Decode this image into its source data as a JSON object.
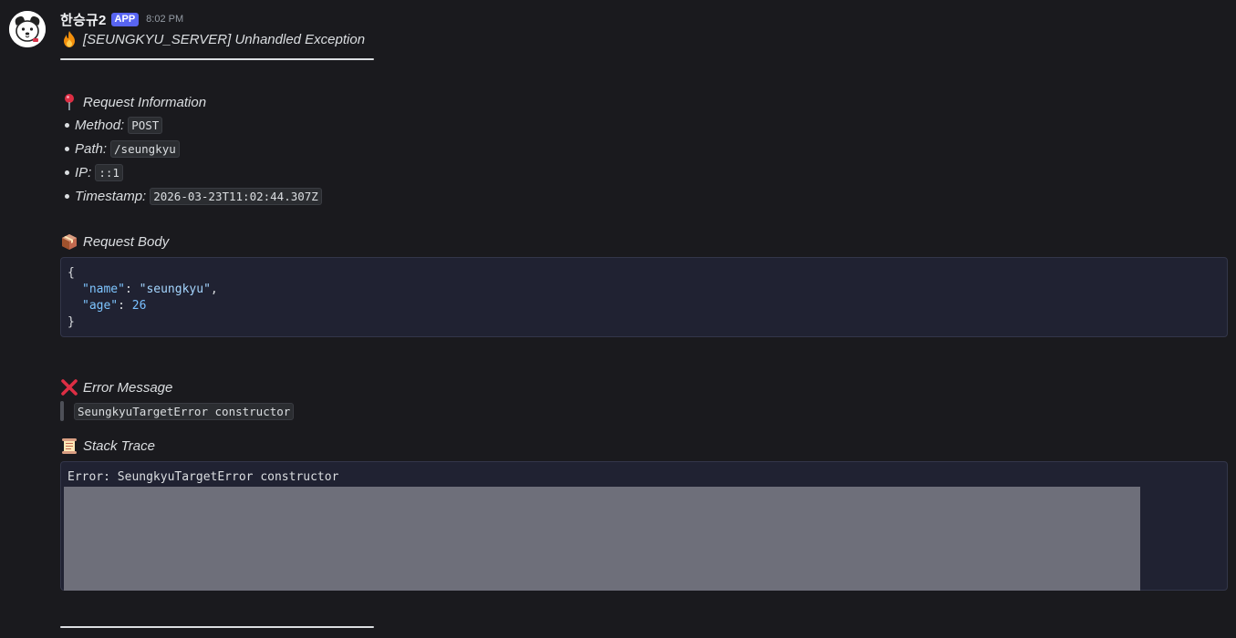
{
  "author": {
    "name": "한승규2",
    "badge": "APP",
    "time": "8:02 PM"
  },
  "title": "[SEUNGKYU_SERVER] Unhandled Exception",
  "sections": {
    "request_info": {
      "heading": "Request Information",
      "items": [
        {
          "label": "Method:",
          "value": "POST"
        },
        {
          "label": "Path:",
          "value": "/seungkyu"
        },
        {
          "label": "IP:",
          "value": "::1"
        },
        {
          "label": "Timestamp:",
          "value": "2026-03-23T11:02:44.307Z"
        }
      ]
    },
    "request_body": {
      "heading": "Request Body",
      "open": "{",
      "close": "}",
      "fields": [
        {
          "key": "\"name\"",
          "value": "\"seungkyu\"",
          "trail": ","
        },
        {
          "key": "\"age\"",
          "value": "26",
          "trail": ""
        }
      ]
    },
    "error_message": {
      "heading": "Error Message",
      "value": "SeungkyuTargetError constructor"
    },
    "stack_trace": {
      "heading": "Stack Trace",
      "first_line": "Error: SeungkyuTargetError constructor"
    }
  },
  "emoji_icons": [
    "fire-icon",
    "pushpin-icon",
    "package-icon",
    "cross-mark-icon",
    "scroll-icon"
  ],
  "colors": {
    "background": "#1a1a1e",
    "badge": "#5865f2",
    "code_block_bg": "#202232",
    "redacted": "#6e6f7a"
  }
}
